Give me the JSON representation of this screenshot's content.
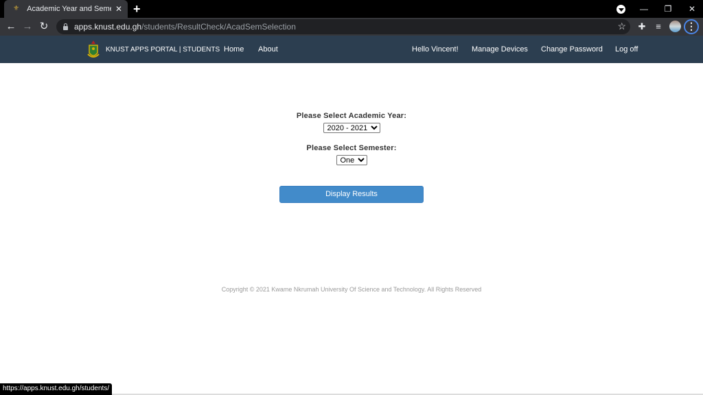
{
  "browser": {
    "tab": {
      "title": "Academic Year and Semester Selection",
      "favicon": "knust-crest-icon"
    },
    "url": {
      "host": "apps.knust.edu.gh",
      "path": "/students/ResultCheck/AcadSemSelection"
    },
    "status_url": "https://apps.knust.edu.gh/students/"
  },
  "navbar": {
    "brand": "KNUST APPS PORTAL | STUDENTS",
    "links": [
      "Home",
      "About"
    ],
    "right_links": [
      "Hello Vincent!",
      "Manage Devices",
      "Change Password",
      "Log off"
    ],
    "color": "#2c3e50"
  },
  "form": {
    "year_label": "Please Select Academic Year:",
    "year_value": "2020 - 2021",
    "semester_label": "Please Select Semester:",
    "semester_value": "One",
    "submit_label": "Display Results",
    "submit_color": "#428bca"
  },
  "footer": {
    "copyright": "Copyright © 2021 Kwame Nkrumah University Of Science and Technology. All Rights Reserved"
  }
}
